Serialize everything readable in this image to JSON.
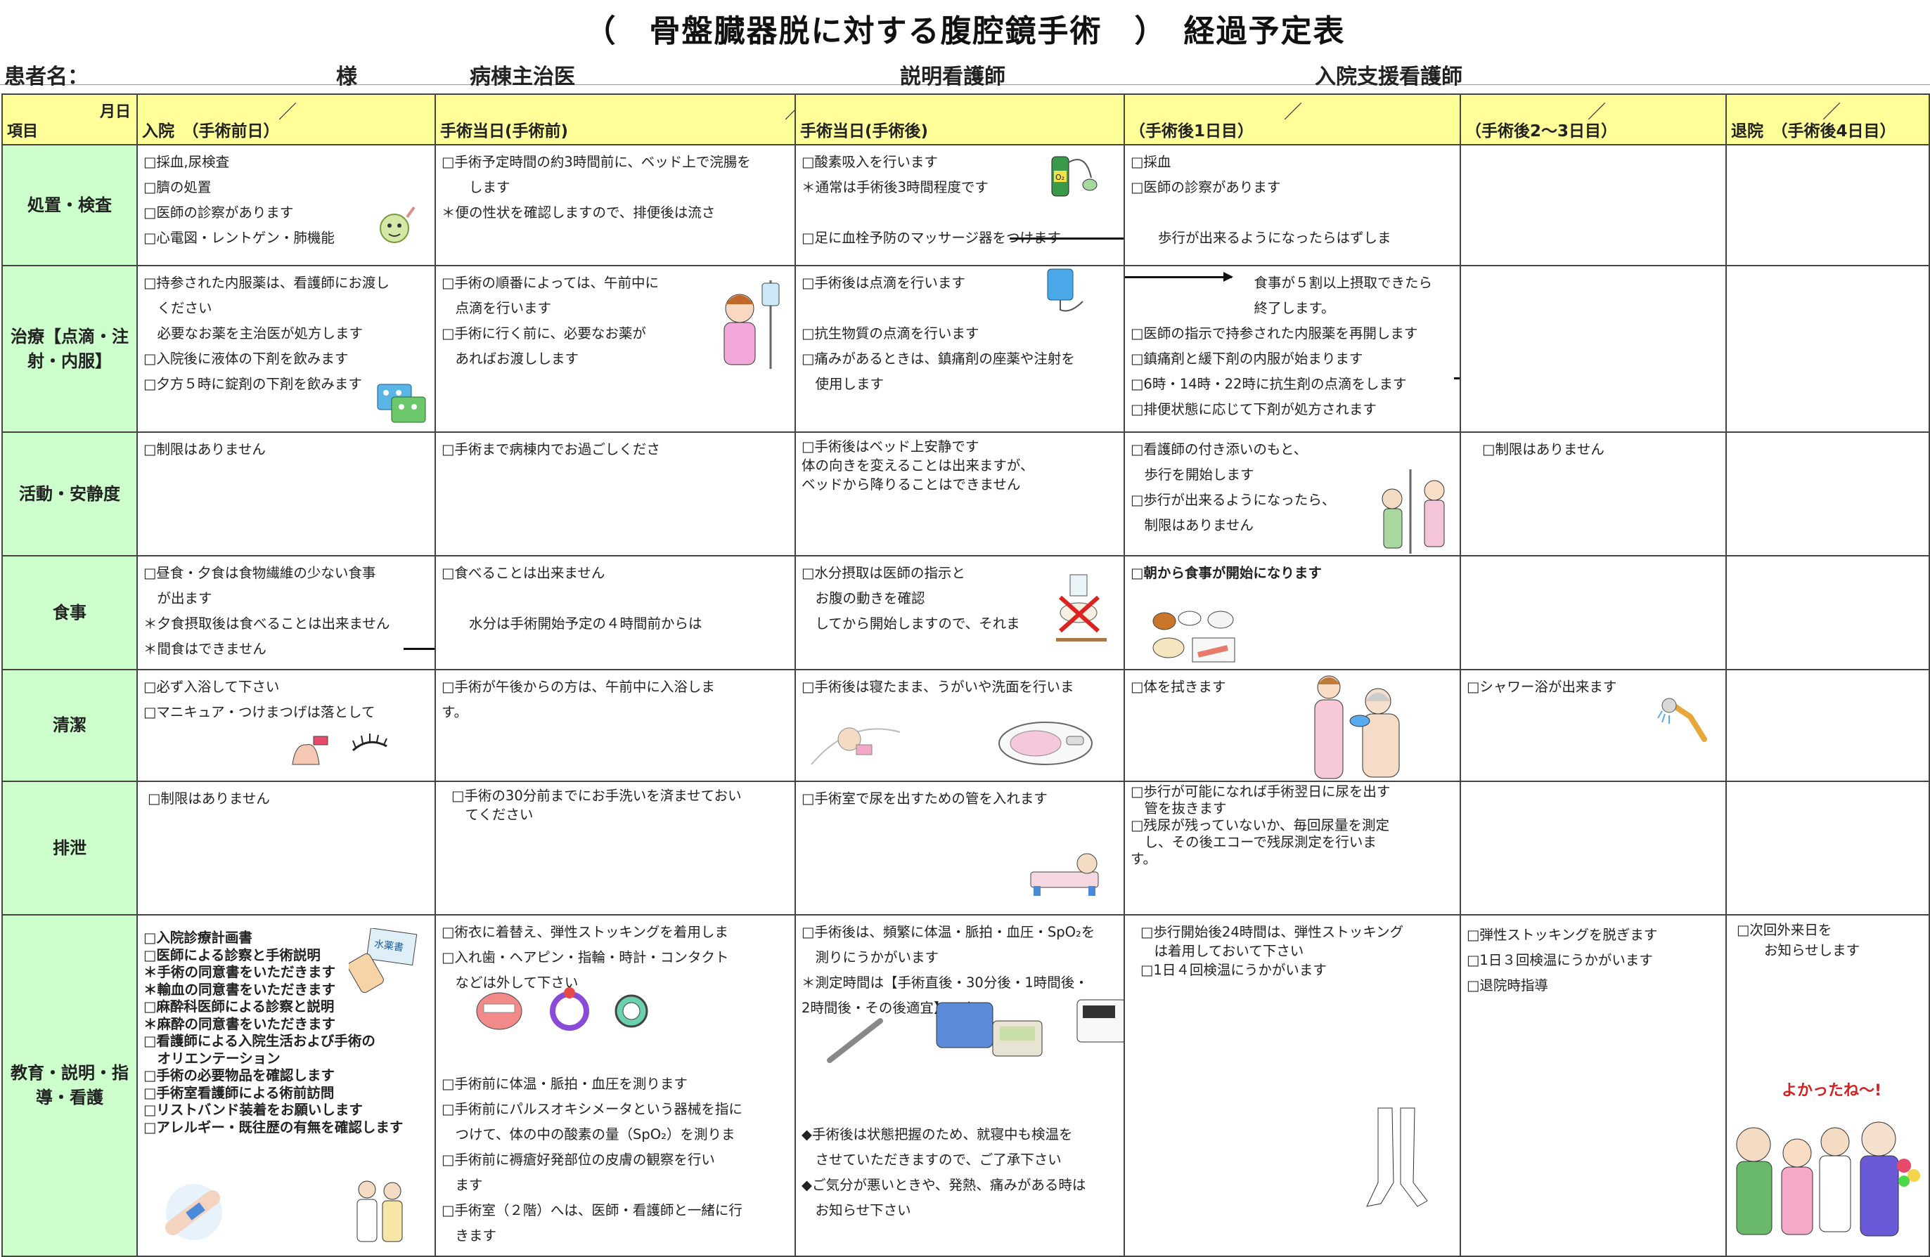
{
  "title": "（　骨盤臓器脱に対する腹腔鏡手術　）　経過予定表",
  "patient_row": {
    "patient_label": "患者名：",
    "sama": "様",
    "ward_doctor": "病棟主治医",
    "explain_nurse": "説明看護師",
    "admission_nurse": "入院支援看護師"
  },
  "corner": {
    "month_day": "月日",
    "item": "項目"
  },
  "columns": [
    {
      "slash": "／",
      "label": "入院　（手術前日）"
    },
    {
      "slash": "／",
      "label": "手術当日(手術前)"
    },
    {
      "slash": "",
      "label": "手術当日(手術後)"
    },
    {
      "slash": "／",
      "label": "（手術後1日目）"
    },
    {
      "slash": "／",
      "label": "（手術後2～3日目）"
    },
    {
      "slash": "／",
      "label": "退院　（手術後4日目）"
    }
  ],
  "rows": [
    {
      "label": "処置・検査",
      "cells": [
        "□採血,尿検査\n□臍の処置\n□医師の診察があります\n□心電図・レントゲン・肺機能",
        "□手術予定時間の約3時間前に、ベッド上で浣腸を\n　　します\n＊便の性状を確認しますので、排便後は流さ",
        "□酸素吸入を行います\n＊通常は手術後3時間程度です\n\n□足に血栓予防のマッサージ器をつけます",
        "□採血\n□医師の診察があります\n\n　　歩行が出来るようになったらはずしま",
        "",
        ""
      ]
    },
    {
      "label": "治療【点滴・注射・内服】",
      "cells": [
        "□持参された内服薬は、看護師にお渡し\n　ください\n　必要なお薬を主治医が処方します\n□入院後に液体の下剤を飲みます\n□夕方５時に錠剤の下剤を飲みます",
        "□手術の順番によっては、午前中に\n　点滴を行います\n□手術に行く前に、必要なお薬が\n　あればお渡しします",
        "□手術後は点滴を行います\n\n□抗生物質の点滴を行います\n□痛みがあるときは、鎮痛剤の座薬や注射を\n　使用します",
        "　　　　　　　　　食事が５割以上摂取できたら\n　　　　　　　　　終了します。\n□医師の指示で持参された内服薬を再開します\n□鎮痛剤と緩下剤の内服が始まります\n□6時・14時・22時に抗生剤の点滴をします\n□排便状態に応じて下剤が処方されます",
        "",
        ""
      ]
    },
    {
      "label": "活動・安静度",
      "cells": [
        "□制限はありません",
        "□手術まで病棟内でお過ごしくださ",
        "□手術後はベッド上安静です\n体の向きを変えることは出来ますが、\nベッドから降りることはできません",
        "□看護師の付き添いのもと、\n　歩行を開始します\n□歩行が出来るようになったら、\n　制限はありません",
        "□制限はありません",
        ""
      ]
    },
    {
      "label": "食事",
      "cells": [
        "□昼食・夕食は食物繊維の少ない食事\n　が出ます\n＊夕食摂取後は食べることは出来ません\n＊間食はできません",
        "□食べることは出来ません\n\n　　水分は手術開始予定の４時間前からは",
        "□水分摂取は医師の指示と\n　お腹の動きを確認\n　してから開始しますので、それま",
        "□朝から食事が開始になります",
        "",
        ""
      ]
    },
    {
      "label": "清潔",
      "cells": [
        "□必ず入浴して下さい\n□マニキュア・つけまつげは落として",
        "□手術が午後からの方は、午前中に入浴しま\nす。",
        "□手術後は寝たまま、うがいや洗面を行いま",
        "□体を拭きます",
        "□シャワー浴が出来ます",
        ""
      ]
    },
    {
      "label": "排泄",
      "cells": [
        "□制限はありません",
        "□手術の30分前までにお手洗いを済ませておい\n　てください",
        "□手術室で尿を出すための管を入れます",
        "□歩行が可能になれば手術翌日に尿を出す\n　管を抜きます\n□残尿が残っていないか、毎回尿量を測定\n　し、その後エコーで残尿測定を行いま\nす。",
        "",
        ""
      ]
    },
    {
      "label": "教育・説明・指導・看護",
      "cells": [
        "□入院診療計画書\n□医師による診察と手術説明\n＊手術の同意書をいただきます\n＊輸血の同意書をいただきます\n□麻酔科医師による診察と説明\n＊麻酔の同意書をいただきます\n□看護師による入院生活および手術の\n　オリエンテーション\n□手術の必要物品を確認します\n□手術室看護師による術前訪問\n□リストバンド装着をお願いします\n□アレルギー・既往歴の有無を確認します",
        "□術衣に着替え、弾性ストッキングを着用しま\n□入れ歯・ヘアピン・指輪・時計・コンタクト\n　などは外して下さい\n\n\n\n□手術前に体温・脈拍・血圧を測ります\n□手術前にパルスオキシメータという器械を指に\n　つけて、体の中の酸素の量（SpO₂）を測りま\n□手術前に褥瘡好発部位の皮膚の観察を行い\n　ます\n□手術室（２階）へは、医師・看護師と一緒に行\n　きます",
        "□手術後は、頻繁に体温・脈拍・血圧・SpO₂を\n　測りにうかがいます\n＊測定時間は【手術直後・30分後・1時間後・\n2時間後・その後適宜】です\n\n\n\n\n◆手術後は状態把握のため、就寝中も検温を\n　させていただきますので、ご了承下さい\n◆ご気分が悪いときや、発熱、痛みがある時は\n　お知らせ下さい",
        "□歩行開始後24時間は、弾性ストッキング\n　は着用しておいて下さい\n□1日４回検温にうかがいます",
        "□弾性ストッキングを脱ぎます\n□1日３回検温にうかがいます\n□退院時指導",
        "□次回外来日を\n　　お知らせします"
      ]
    }
  ],
  "illustrations": {
    "pills_book": "水薬書",
    "celebrate": "よかったね〜!"
  },
  "colors": {
    "header_yellow": "#ffff99",
    "rowhead_green": "#ccffcc",
    "border": "#444444"
  }
}
